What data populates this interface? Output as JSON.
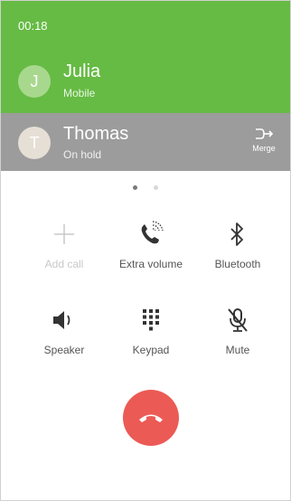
{
  "status": {
    "call_timer": "00:18"
  },
  "active_call": {
    "initial": "J",
    "name": "Julia",
    "subtitle": "Mobile",
    "color": "#66bb44"
  },
  "held_call": {
    "initial": "T",
    "name": "Thomas",
    "subtitle": "On hold",
    "merge_label": "Merge",
    "color": "#9c9c9c"
  },
  "pager": {
    "pages": 2,
    "current": 1
  },
  "actions": {
    "add_call": {
      "label": "Add call",
      "icon": "plus-icon",
      "enabled": false
    },
    "extra_volume": {
      "label": "Extra volume",
      "icon": "phone-volume-icon",
      "enabled": true
    },
    "bluetooth": {
      "label": "Bluetooth",
      "icon": "bluetooth-icon",
      "enabled": true
    },
    "speaker": {
      "label": "Speaker",
      "icon": "speaker-icon",
      "enabled": true
    },
    "keypad": {
      "label": "Keypad",
      "icon": "keypad-icon",
      "enabled": true
    },
    "mute": {
      "label": "Mute",
      "icon": "mic-mute-icon",
      "enabled": true
    }
  },
  "end_call": {
    "icon": "end-call-icon",
    "color": "#ec5a55"
  }
}
